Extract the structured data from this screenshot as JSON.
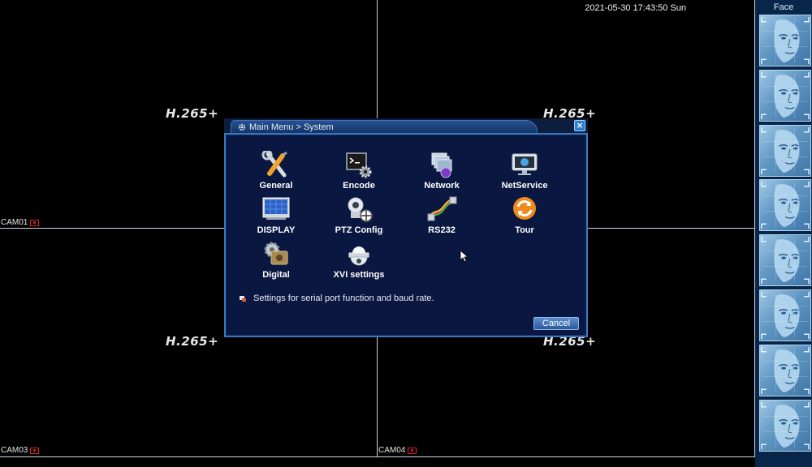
{
  "grid": {
    "codec_labels": [
      "H.265+",
      "H.265+",
      "H.265+",
      "H.265+"
    ],
    "cameras": [
      "CAM01",
      "CAM03",
      "CAM04"
    ],
    "datetime": "2021-05-30 17:43:50 Sun"
  },
  "face_panel": {
    "title": "Face",
    "thumbnail_count": 8
  },
  "dialog": {
    "title": "Main Menu > System",
    "items": [
      {
        "label": "General",
        "icon": "general-tools-icon"
      },
      {
        "label": "Encode",
        "icon": "encode-icon"
      },
      {
        "label": "Network",
        "icon": "network-icon"
      },
      {
        "label": "NetService",
        "icon": "netservice-icon"
      },
      {
        "label": "DISPLAY",
        "icon": "display-icon"
      },
      {
        "label": "PTZ Config",
        "icon": "ptz-camera-icon"
      },
      {
        "label": "RS232",
        "icon": "rs232-cable-icon"
      },
      {
        "label": "Tour",
        "icon": "tour-refresh-icon"
      },
      {
        "label": "Digital",
        "icon": "digital-gear-icon"
      },
      {
        "label": "XVI settings",
        "icon": "dome-camera-icon"
      }
    ],
    "hint": "Settings for serial port function and baud rate.",
    "cancel_label": "Cancel",
    "close_label": "×"
  },
  "colors": {
    "dialog_bg": "#0a1740",
    "dialog_border": "#3b78c4",
    "face_panel_bg": "#08264a",
    "record_red": "#d8242a"
  }
}
